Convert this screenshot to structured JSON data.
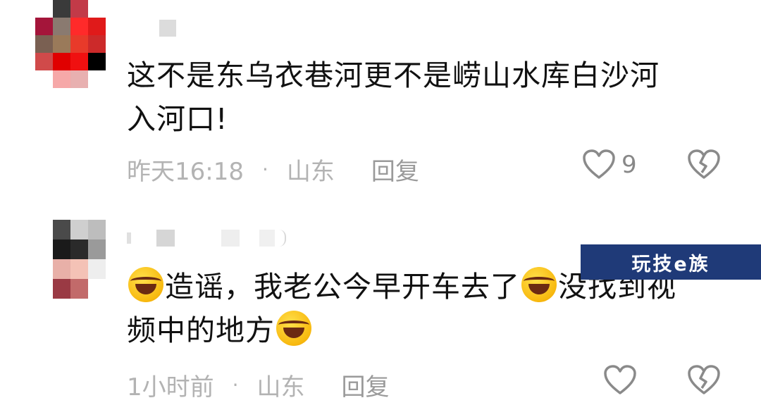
{
  "comments": [
    {
      "username": "",
      "text_line1": "这不是东乌衣巷河更不是崂山水库白沙河",
      "text_line2": "入河口!",
      "time": "昨天16:18",
      "separator": "·",
      "region": "山东",
      "reply_label": "回复",
      "like_count": "9",
      "like_icon": "heart-outline-icon",
      "dislike_icon": "broken-heart-icon"
    },
    {
      "username": "",
      "text_part1": "造谣，我老公今早开车去了",
      "text_part2": "没找到视",
      "text_line2": "频中的地方",
      "emoji_icon": "rofl-emoji-icon",
      "time": "1小时前",
      "separator": "·",
      "region": "山东",
      "reply_label": "回复",
      "like_count": "",
      "like_icon": "heart-outline-icon",
      "dislike_icon": "broken-heart-icon"
    }
  ],
  "watermark": {
    "text": "玩技e族"
  },
  "colors": {
    "meta_gray": "#b3b3b3",
    "icon_gray": "#8a8a8a",
    "watermark_bg": "#1f3a78"
  }
}
